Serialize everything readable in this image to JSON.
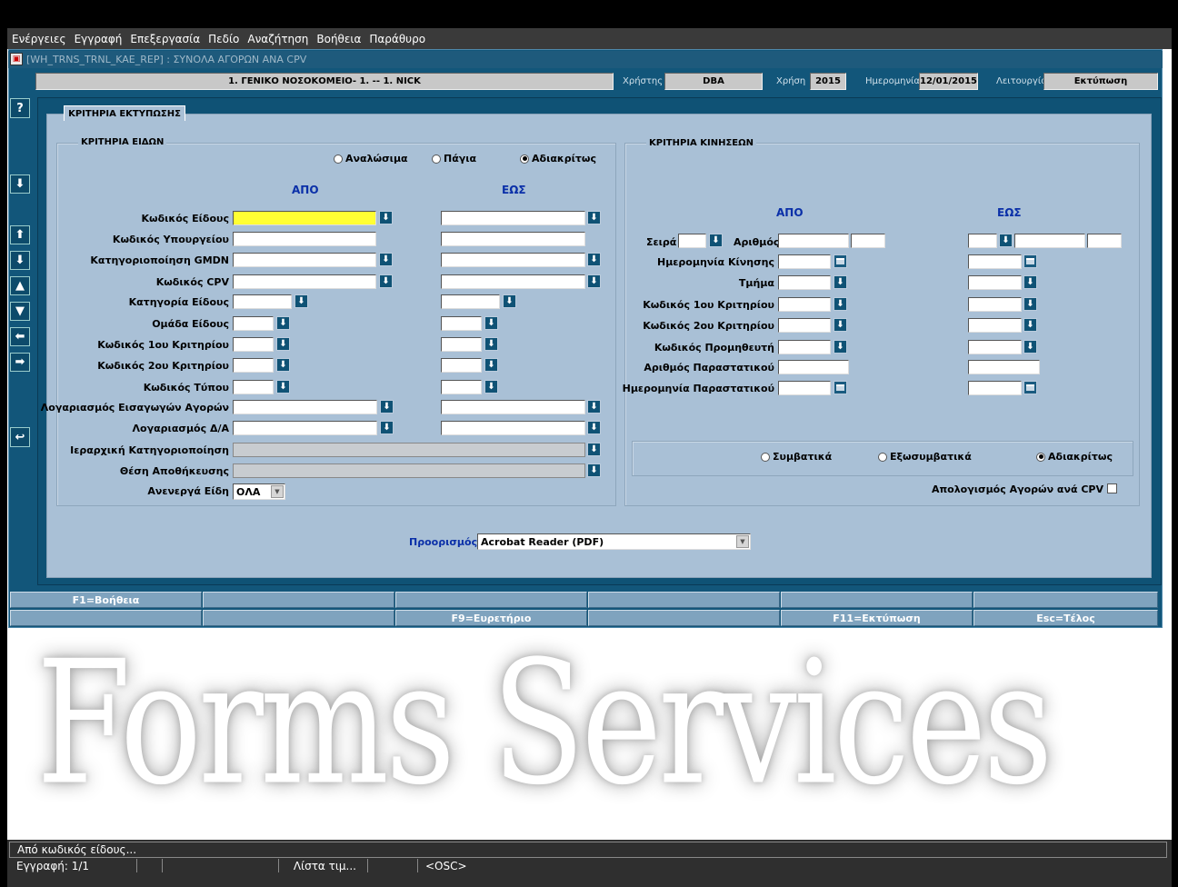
{
  "menu": [
    "Ενέργειες",
    "Εγγραφή",
    "Επεξεργασία",
    "Πεδίο",
    "Αναζήτηση",
    "Βοήθεια",
    "Παράθυρο"
  ],
  "window": {
    "title": "[WH_TRNS_TRNL_KAE_REP]  :  ΣΥΝΟΛΑ ΑΓΟΡΩΝ ΑΝΑ CPV"
  },
  "header": {
    "org": "1. ΓΕΝΙΚΟ ΝΟΣΟΚΟΜΕΙΟ- 1. -- 1. NICK",
    "user_label": "Χρήστης",
    "user": "DBA",
    "year_label": "Χρήση",
    "year": "2015",
    "date_label": "Ημερομηνία",
    "date": "12/01/2015",
    "function_label": "Λειτουργία",
    "function": "Εκτύπωση"
  },
  "toolbar": {
    "help": "?"
  },
  "tab": {
    "label": "ΚΡΙΤΗΡΙΑ ΕΚΤΥΠΩΣΗΣ"
  },
  "items_group": {
    "title": "ΚΡΙΤΗΡΙΑ ΕΙΔΩΝ",
    "radios": [
      {
        "label": "Αναλώσιμα",
        "checked": false
      },
      {
        "label": "Πάγια",
        "checked": false
      },
      {
        "label": "Αδιακρίτως",
        "checked": true
      }
    ],
    "from_head": "ΑΠΟ",
    "to_head": "ΕΩΣ",
    "labels": [
      "Κωδικός Είδους",
      "Κωδικός Υπουργείου",
      "Κατηγοριοποίηση GMDN",
      "Κωδικός CPV",
      "Κατηγορία Είδους",
      "Ομάδα Είδους",
      "Κωδικός 1ου Κριτηρίου",
      "Κωδικός 2ου Κριτηρίου",
      "Κωδικός Τύπου",
      "Λογαριασμός Εισαγωγών Αγορών",
      "Λογαριασμός Δ/Α",
      "Ιεραρχική Κατηγοριοποίηση",
      "Θέση Αποθήκευσης",
      "Ανενεργά Είδη"
    ],
    "inactive_value": "ΟΛΑ"
  },
  "moves_group": {
    "title": "ΚΡΙΤΗΡΙΑ ΚΙΝΗΣΕΩΝ",
    "from_head": "ΑΠΟ",
    "to_head": "ΕΩΣ",
    "series_label": "Σειρά",
    "number_label": "Αριθμός",
    "labels": [
      "Ημερομηνία Κίνησης",
      "Τμήμα",
      "Κωδικός 1ου Κριτηρίου",
      "Κωδικός 2ου Κριτηρίου",
      "Κωδικός Προμηθευτή",
      "Αριθμός Παραστατικού",
      "Ημερομηνία Παραστατικού"
    ],
    "radios": [
      {
        "label": "Συμβατικά",
        "checked": false
      },
      {
        "label": "Εξωσυμβατικά",
        "checked": false
      },
      {
        "label": "Αδιακρίτως",
        "checked": true
      }
    ],
    "cpv_check_label": "Απολογισμός Αγορών ανά CPV"
  },
  "destination": {
    "label": "Προορισμός",
    "value": "Acrobat Reader (PDF)"
  },
  "keys": {
    "row1": [
      "F1=Βοήθεια",
      "",
      "",
      "",
      "",
      ""
    ],
    "row2": [
      "",
      "",
      "F9=Ευρετήριο",
      "",
      "F11=Εκτύπωση",
      "Esc=Τέλος"
    ]
  },
  "watermark": "Forms Services",
  "status": {
    "message": "Από κωδικός είδους...",
    "record": "Εγγραφή: 1/1",
    "list": "Λίστα τιμ...",
    "mode": "<OSC>"
  }
}
